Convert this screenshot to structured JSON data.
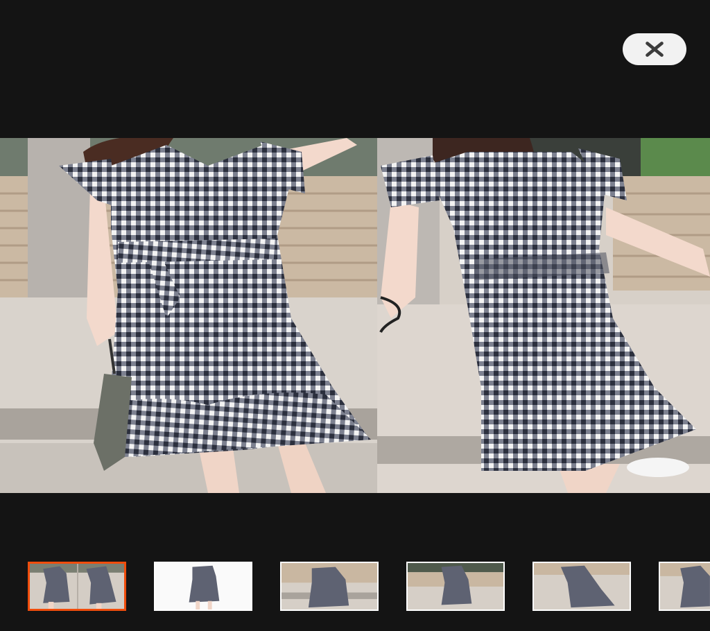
{
  "viewer": {
    "close_icon": "close-icon",
    "main_image": {
      "subject": "gingham-dress-front-and-back",
      "colors": {
        "background": "#141414",
        "fabric_dark": "#2b2f3d",
        "fabric_light": "#f3f3f3",
        "pavement": "#cfc8c0",
        "accent_active_thumb": "#f04d0c"
      }
    },
    "thumbnails": [
      {
        "id": "thumb-1",
        "active": true,
        "scene": "two-views-street"
      },
      {
        "id": "thumb-2",
        "active": false,
        "scene": "white-studio"
      },
      {
        "id": "thumb-3",
        "active": false,
        "scene": "bench-street"
      },
      {
        "id": "thumb-4",
        "active": false,
        "scene": "street-walking"
      },
      {
        "id": "thumb-5",
        "active": false,
        "scene": "street-turning"
      },
      {
        "id": "thumb-6",
        "active": false,
        "scene": "street-partial"
      }
    ]
  }
}
